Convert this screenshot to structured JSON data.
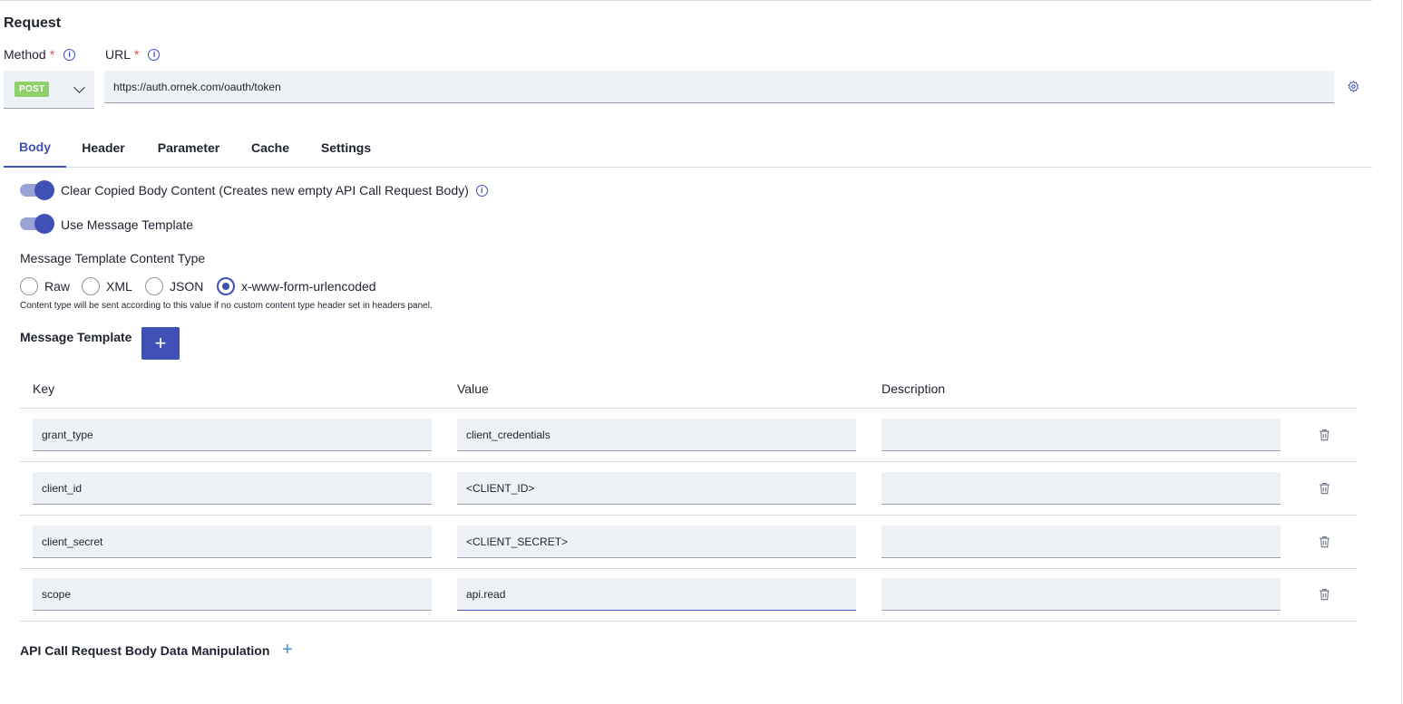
{
  "request": {
    "title": "Request",
    "method_label": "Method",
    "url_label": "URL",
    "required_mark": "*",
    "info_glyph": "i",
    "method_value": "POST",
    "url_value": "https://auth.ornek.com/oauth/token"
  },
  "tabs": [
    {
      "label": "Body",
      "active": true
    },
    {
      "label": "Header",
      "active": false
    },
    {
      "label": "Parameter",
      "active": false
    },
    {
      "label": "Cache",
      "active": false
    },
    {
      "label": "Settings",
      "active": false
    }
  ],
  "body": {
    "toggle_clear_label": "Clear Copied Body Content (Creates new empty API Call Request Body)",
    "toggle_clear_on": true,
    "toggle_template_label": "Use Message Template",
    "toggle_template_on": true,
    "content_type_heading": "Message Template Content Type",
    "content_types": [
      "Raw",
      "XML",
      "JSON",
      "x-www-form-urlencoded"
    ],
    "content_type_selected": "x-www-form-urlencoded",
    "content_type_hint": "Content type will be sent according to this value if no custom content type header set in headers panel.",
    "message_template_title": "Message Template",
    "add_glyph": "+"
  },
  "table": {
    "headers": {
      "key": "Key",
      "value": "Value",
      "description": "Description"
    },
    "rows": [
      {
        "key": "grant_type",
        "value": "client_credentials",
        "description": ""
      },
      {
        "key": "client_id",
        "value": "<CLIENT_ID>",
        "description": ""
      },
      {
        "key": "client_secret",
        "value": "<CLIENT_SECRET>",
        "description": ""
      },
      {
        "key": "scope",
        "value": "api.read",
        "description": ""
      }
    ]
  },
  "manipulation": {
    "title": "API Call Request Body Data Manipulation",
    "add_glyph": "+"
  },
  "colors": {
    "accent": "#3f51b5",
    "post_badge": "#8fd06a",
    "required": "#e5484d",
    "input_bg": "#eef1f6"
  },
  "icons": [
    "info-icon",
    "chevron-down-icon",
    "gear-icon",
    "plus-icon",
    "trash-icon"
  ]
}
